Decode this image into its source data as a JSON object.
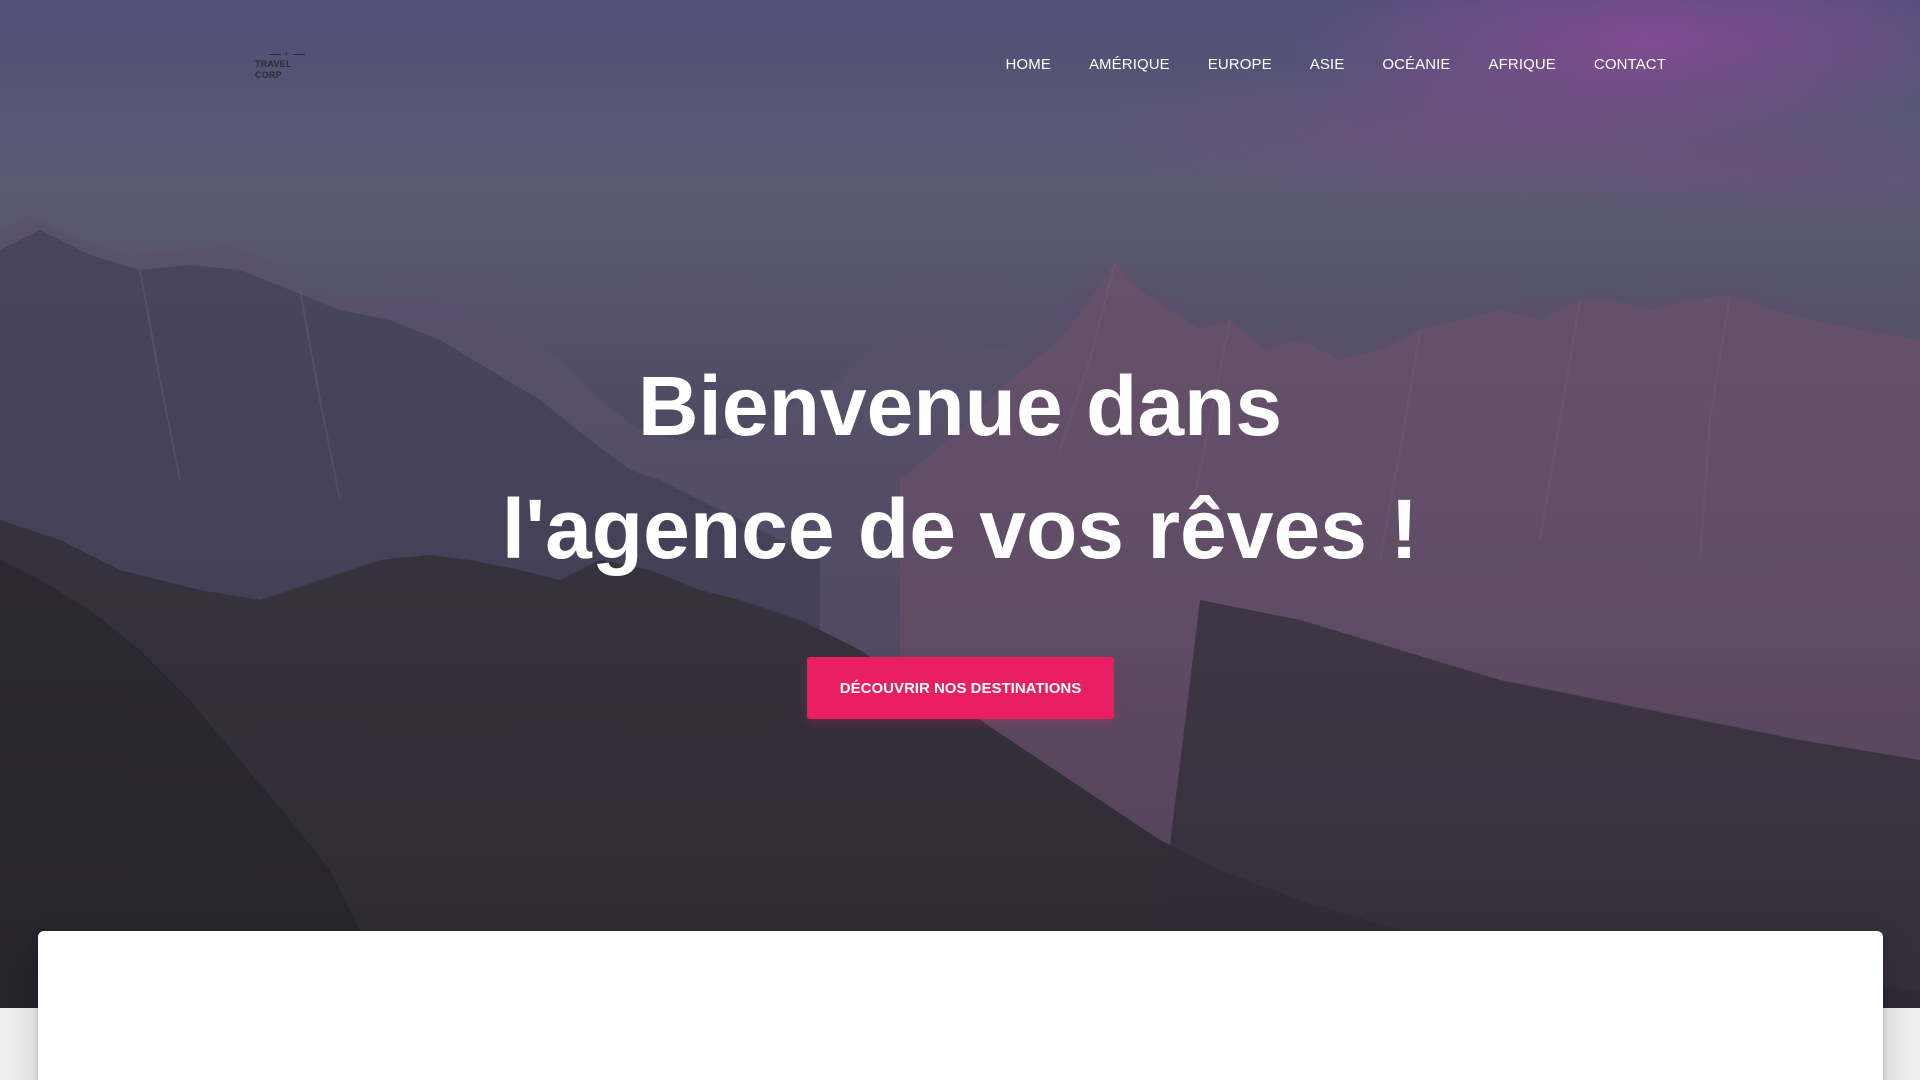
{
  "logo": {
    "text": "TRAVEL CORP"
  },
  "nav": {
    "items": [
      {
        "label": "HOME"
      },
      {
        "label": "AMÉRIQUE"
      },
      {
        "label": "EUROPE"
      },
      {
        "label": "ASIE"
      },
      {
        "label": "OCÉANIE"
      },
      {
        "label": "AFRIQUE"
      },
      {
        "label": "CONTACT"
      }
    ]
  },
  "hero": {
    "title_line1": "Bienvenue dans",
    "title_line2": "l'agence de vos rêves !",
    "cta_label": "DÉCOUVRIR NOS DESTINATIONS"
  },
  "colors": {
    "accent": "#e91e63",
    "nav_text": "#ffffff",
    "card_bg": "#ffffff"
  }
}
